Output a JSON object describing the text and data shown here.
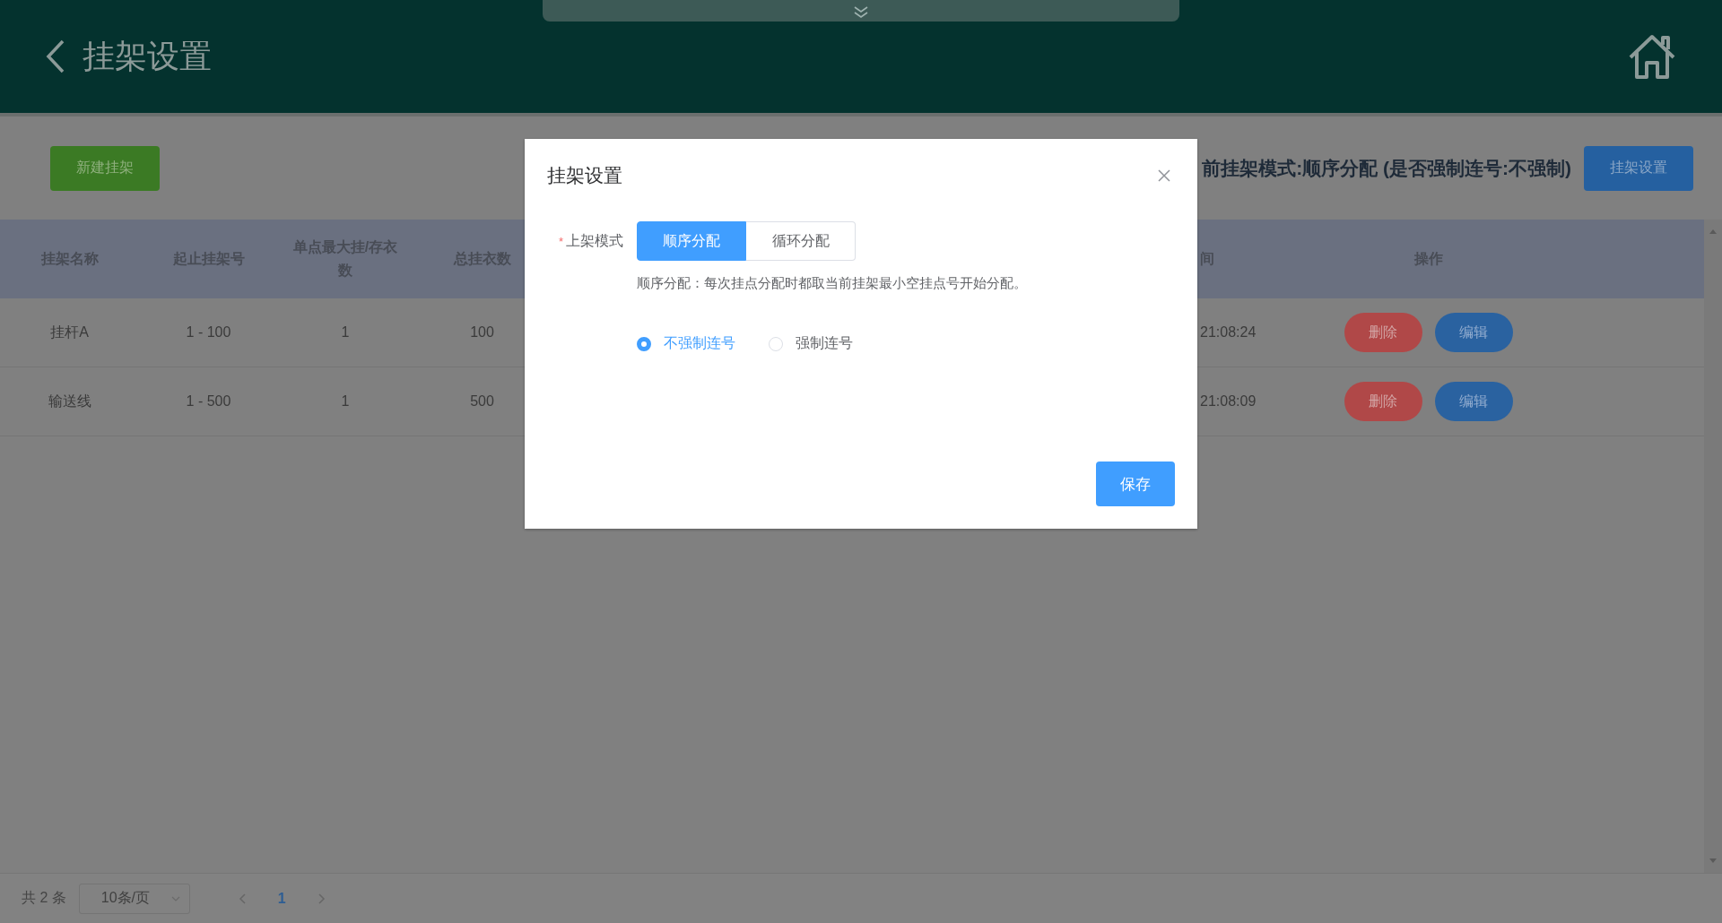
{
  "header": {
    "title": "挂架设置"
  },
  "toolbar": {
    "new_button": "新建挂架",
    "mode_text": "前挂架模式:顺序分配 (是否强制连号:不强制)",
    "settings_button": "挂架设置"
  },
  "table": {
    "columns": [
      "挂架名称",
      "起止挂架号",
      "单点最大挂/存衣数",
      "总挂衣数",
      "间",
      "操作"
    ],
    "rows": [
      {
        "name": "挂杆A",
        "range": "1 - 100",
        "max": "1",
        "total": "100",
        "time": "21:08:24",
        "actions": [
          {
            "label": "删除",
            "kind": "delete"
          },
          {
            "label": "编辑",
            "kind": "edit"
          }
        ]
      },
      {
        "name": "输送线",
        "range": "1 - 500",
        "max": "1",
        "total": "500",
        "time": "21:08:09",
        "actions": [
          {
            "label": "删除",
            "kind": "delete"
          },
          {
            "label": "编辑",
            "kind": "edit"
          }
        ]
      }
    ]
  },
  "pagination": {
    "total": "共 2 条",
    "page_size": "10条/页",
    "pages": [
      {
        "label": "1",
        "selected": true
      }
    ]
  },
  "dialog": {
    "title": "挂架设置",
    "required_mark": "*",
    "field_label": "上架模式",
    "modes": [
      {
        "label": "顺序分配",
        "selected": true
      },
      {
        "label": "循环分配",
        "selected": false
      }
    ],
    "description": "顺序分配：每次挂点分配时都取当前挂架最小空挂点号开始分配。",
    "options": [
      {
        "label": "不强制连号",
        "selected": true
      },
      {
        "label": "强制连号",
        "selected": false
      }
    ],
    "save_button": "保存"
  }
}
